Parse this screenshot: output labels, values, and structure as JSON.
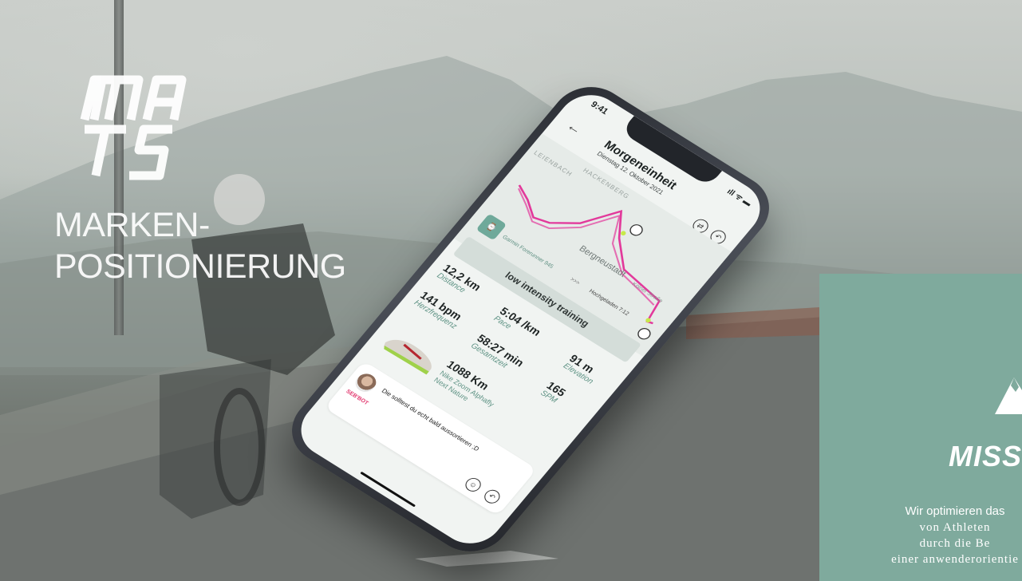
{
  "headline": {
    "line1": "MARKEN-",
    "line2": "POSITIONIERUNG"
  },
  "phone": {
    "status_time": "9:41",
    "status_icons": "ıll ᯤ ▬",
    "back_icon": "←",
    "title": "Morgeneinheit",
    "subtitle": "Dienstag 12. Oktober 2021",
    "map": {
      "labels": [
        "LEIENBACH",
        "HACKENBERG"
      ],
      "town": "Bergneustadt",
      "street": "Kölner Straße"
    },
    "device": {
      "name": "Garmin Forerunner 945",
      "arrows": ">>>",
      "upload": "Hochgeladen 7:12"
    },
    "training_type": "low intensity training",
    "stats": {
      "distance": {
        "value": "12,2 km",
        "label": "Distance"
      },
      "pace": {
        "value": "5:04 /km",
        "label": "Pace"
      },
      "elevation": {
        "value": "91 m",
        "label": "Elevation"
      },
      "heart": {
        "value": "141 bpm",
        "label": "Herzfrequenz"
      },
      "time": {
        "value": "58:27 min",
        "label": "Gesamtzeit"
      },
      "spm": {
        "value": "165",
        "label": "SPM"
      }
    },
    "shoe": {
      "km": "1088 Km",
      "name_line1": "Nike Zoom Alphafly",
      "name_line2": "Next Nature"
    },
    "chat": {
      "bot": "SEB'BOT",
      "message": "Die solltest du echt bald aussortieren ;D"
    }
  },
  "mission": {
    "title": "MISS",
    "line1": "Wir optimieren das",
    "line2": "von Athleten",
    "line3": "durch die Be",
    "line4": "einer anwenderorientie"
  },
  "colors": {
    "accent_green": "#7faa9d",
    "route_pink": "#e2399b",
    "label_green": "#5f9385"
  }
}
